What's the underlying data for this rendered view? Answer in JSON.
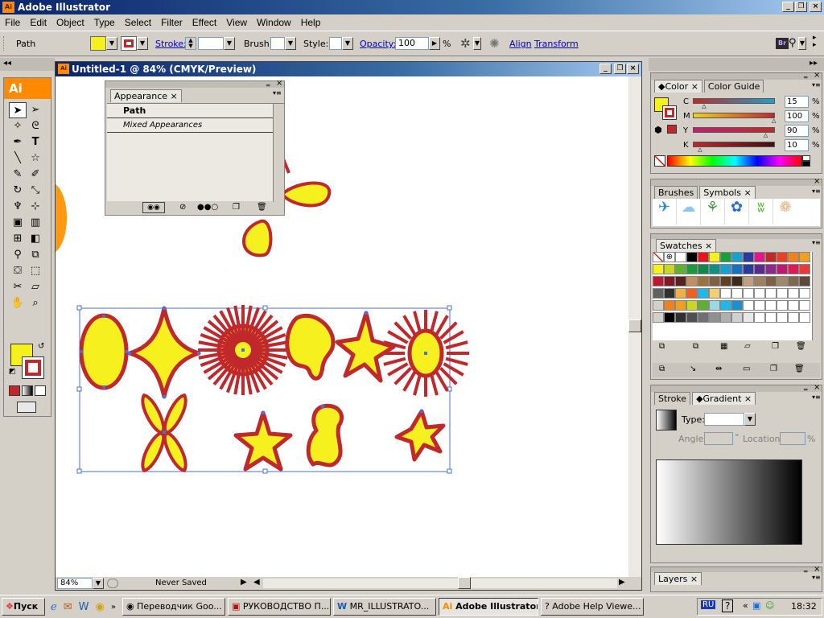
{
  "app": {
    "title": "Adobe Illustrator",
    "icon": "ai-logo-icon"
  },
  "menu": [
    "File",
    "Edit",
    "Object",
    "Type",
    "Select",
    "Filter",
    "Effect",
    "View",
    "Window",
    "Help"
  ],
  "control": {
    "selection_label": "Path",
    "stroke_label": "Stroke:",
    "brush_label": "Brush:",
    "style_label": "Style:",
    "opacity_label": "Opacity:",
    "opacity_value": "100",
    "opacity_unit": "%",
    "align_label": "Align",
    "transform_label": "Transform",
    "fill_color": "#f6f01e",
    "stroke_color": "#c0282c"
  },
  "document": {
    "title": "Untitled-1 @ 84% (CMYK/Preview)"
  },
  "appearance": {
    "tab": "Appearance",
    "row_path": "Path",
    "row_mixed": "Mixed Appearances"
  },
  "color_panel": {
    "tabs": [
      "Color",
      "Color Guide"
    ],
    "channels": [
      {
        "label": "C",
        "value": "15",
        "unit": "%",
        "fraction": 0.15
      },
      {
        "label": "M",
        "value": "100",
        "unit": "%",
        "fraction": 1.0
      },
      {
        "label": "Y",
        "value": "90",
        "unit": "%",
        "fraction": 0.9
      },
      {
        "label": "K",
        "value": "10",
        "unit": "%",
        "fraction": 0.1
      }
    ]
  },
  "brushes_panel": {
    "tabs": [
      "Brushes",
      "Symbols"
    ]
  },
  "swatches_panel": {
    "tab": "Swatches"
  },
  "stroke_panel": {
    "tabs": [
      "Stroke",
      "Gradient"
    ],
    "type_label": "Type:",
    "angle_label": "Angle:",
    "location_label": "Location:",
    "location_unit": "%"
  },
  "layers_panel": {
    "tab": "Layers"
  },
  "status": {
    "zoom": "84%",
    "state": "Never Saved"
  },
  "taskbar": {
    "start": "Пуск",
    "buttons": [
      "Переводчик Goo...",
      "РУКОВОДСТВО П...",
      "MR_ILLUSTRATO...",
      "Adobe Illustrator",
      "Adobe Help Viewe..."
    ],
    "lang": "RU",
    "clock": "18:32"
  },
  "colors": {
    "accent": "#0a246a",
    "fill": "#f6f01e",
    "stroke": "#c0282c",
    "selection": "#4a6fd8"
  }
}
